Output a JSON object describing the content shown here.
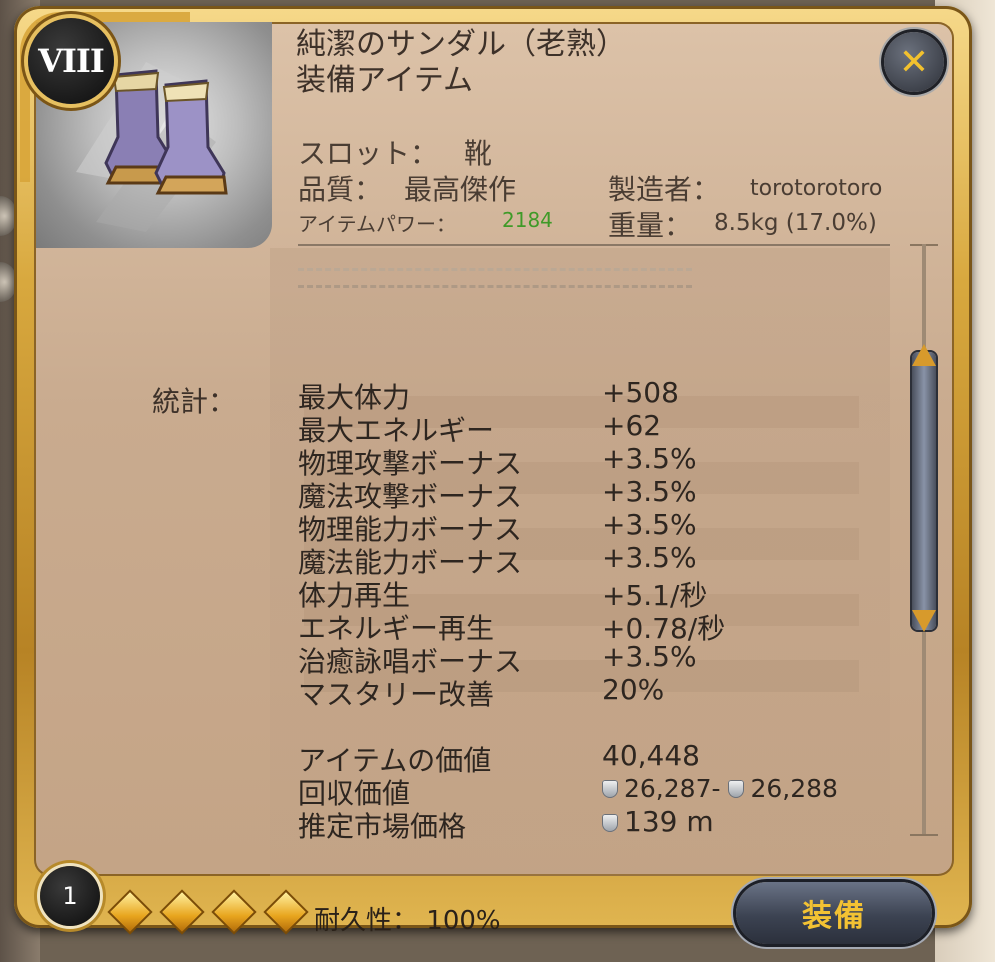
{
  "item": {
    "tier": "VIII",
    "name": "純潔のサンダル（老熟）",
    "category": "装備アイテム",
    "icon": "boots-icon",
    "slot_label": "スロット：",
    "slot_value": "靴",
    "quality_label": "品質：",
    "quality_value": "最高傑作",
    "power_label": "アイテムパワー：",
    "power_value": "2184",
    "crafter_label": "製造者：",
    "crafter_value": "torotorotoro",
    "weight_label": "重量：",
    "weight_value": "8.5kg (17.0%)"
  },
  "stats": {
    "label": "統計：",
    "rows": [
      {
        "name": "最大体力",
        "value": "+508"
      },
      {
        "name": "最大エネルギー",
        "value": "+62"
      },
      {
        "name": "物理攻撃ボーナス",
        "value": "+3.5%"
      },
      {
        "name": "魔法攻撃ボーナス",
        "value": "+3.5%"
      },
      {
        "name": "物理能力ボーナス",
        "value": "+3.5%"
      },
      {
        "name": "魔法能力ボーナス",
        "value": "+3.5%"
      },
      {
        "name": "体力再生",
        "value": "+5.1/秒"
      },
      {
        "name": "エネルギー再生",
        "value": "+0.78/秒"
      },
      {
        "name": "治癒詠唱ボーナス",
        "value": "+3.5%"
      },
      {
        "name": "マスタリー改善",
        "value": "20%"
      }
    ]
  },
  "value": {
    "item_value_label": "アイテムの価値",
    "item_value": "40,448",
    "salvage_label": "回収価値",
    "salvage_min": "26,287-",
    "salvage_max": "26,288",
    "market_label": "推定市場価格",
    "market_value": "139 m",
    "coin_icon": "silver-coin-icon"
  },
  "footer": {
    "level": "1",
    "enchant_diamonds": 4,
    "durability_label": "耐久性：",
    "durability_value": "100%",
    "equip_label": "装備"
  },
  "colors": {
    "frame_gold": "#d8a83e",
    "panel": "#c9ab8f",
    "item_power_green": "#3f9a28",
    "button_text_gold": "#f3c233"
  }
}
